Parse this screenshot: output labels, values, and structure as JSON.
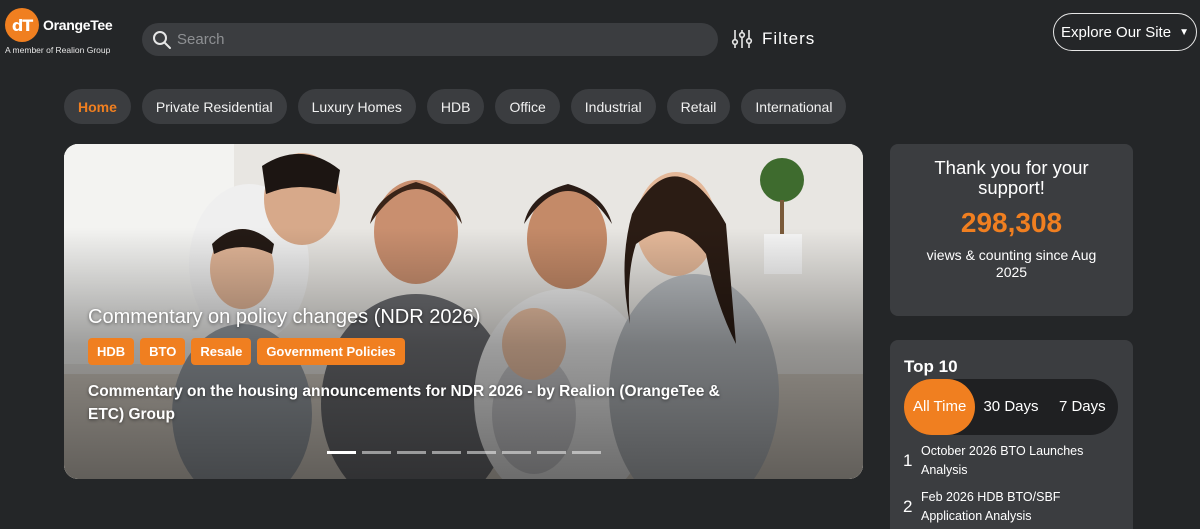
{
  "logo": {
    "mark": "dT",
    "name": "OrangeTee",
    "tagline": "A member of Realion Group"
  },
  "search": {
    "placeholder": "Search"
  },
  "filters": {
    "label": "Filters"
  },
  "explore": {
    "label": "Explore Our Site"
  },
  "nav": [
    {
      "label": "Home",
      "active": true
    },
    {
      "label": "Private Residential"
    },
    {
      "label": "Luxury Homes"
    },
    {
      "label": "HDB"
    },
    {
      "label": "Office"
    },
    {
      "label": "Industrial"
    },
    {
      "label": "Retail"
    },
    {
      "label": "International"
    }
  ],
  "hero": {
    "title": "Commentary on policy changes (NDR 2026)",
    "tags": [
      "HDB",
      "BTO",
      "Resale",
      "Government Policies"
    ],
    "description": "Commentary on the housing announcements for NDR 2026 - by Realion (OrangeTee & ETC) Group",
    "slide_count": 8,
    "active_slide": 1
  },
  "views_card": {
    "heading": "Thank you for your support!",
    "count": "298,308",
    "caption": "views & counting since Aug 2025"
  },
  "top10": {
    "title": "Top 10",
    "tabs": [
      "All Time",
      "30 Days",
      "7 Days"
    ],
    "active_tab": 0,
    "items": [
      {
        "rank": "1",
        "title": "October 2026 BTO Launches Analysis"
      },
      {
        "rank": "2",
        "title": "Feb 2026 HDB BTO/SBF Application Analysis"
      }
    ]
  },
  "colors": {
    "accent": "#f07f20",
    "background": "#242628",
    "surface": "#3b3d40"
  },
  "icons": [
    "search-icon",
    "filters-icon",
    "chevron-down-icon"
  ]
}
